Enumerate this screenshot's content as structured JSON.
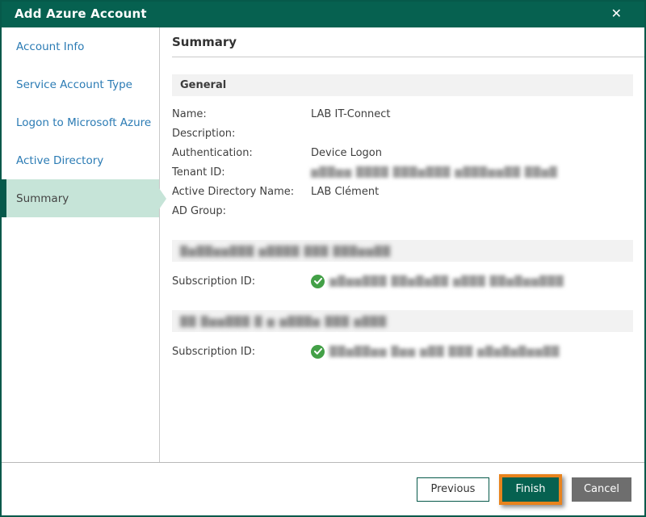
{
  "window": {
    "title": "Add Azure Account",
    "close_icon": "✕"
  },
  "colors": {
    "titlebar_green": "#066150",
    "selected_step_bg": "#c6e4d8",
    "step_link_blue": "#2b7bb4",
    "check_green": "#43a047",
    "highlight_orange": "#e8831d",
    "cancel_gray": "#6e6e6e"
  },
  "sidebar": {
    "items": [
      {
        "label": "Account Info",
        "active": false
      },
      {
        "label": "Service Account Type",
        "active": false
      },
      {
        "label": "Logon to Microsoft Azure",
        "active": false
      },
      {
        "label": "Active Directory",
        "active": false
      },
      {
        "label": "Summary",
        "active": true
      }
    ]
  },
  "content": {
    "heading": "Summary",
    "sections": [
      {
        "title": "General",
        "title_redacted": false,
        "rows": [
          {
            "label": "Name:",
            "value": "LAB IT-Connect",
            "redacted": false,
            "check": false
          },
          {
            "label": "Description:",
            "value": "",
            "redacted": false,
            "check": false
          },
          {
            "label": "Authentication:",
            "value": "Device Logon",
            "redacted": false,
            "check": false
          },
          {
            "label": "Tenant ID:",
            "value": "▆██▆▆ ████ ███▆███ ▆███▆▆██ ██▆█",
            "redacted": true,
            "check": false
          },
          {
            "label": "Active Directory Name:",
            "value": "LAB Clément",
            "redacted": false,
            "check": false
          },
          {
            "label": "AD Group:",
            "value": "",
            "redacted": false,
            "check": false
          }
        ]
      },
      {
        "title": "█▆██▆▆███ ▆████ ███ ███▆▆██",
        "title_redacted": true,
        "rows": [
          {
            "label": "Subscription ID:",
            "value": "▆█▆▆███ ██▆█▆██ ▆███ ██▆█▆▆███",
            "redacted": true,
            "check": true
          }
        ]
      },
      {
        "title": "██ █▆▆███ █ ▆  ▆███▆ ███ ▆███",
        "title_redacted": true,
        "rows": [
          {
            "label": "Subscription ID:",
            "value": "██▆██▆▆ █▆▆ ▆██ ███ ▆█▆█▆█▆▆██",
            "redacted": true,
            "check": true
          }
        ]
      }
    ]
  },
  "footer": {
    "previous_label": "Previous",
    "finish_label": "Finish",
    "cancel_label": "Cancel"
  }
}
